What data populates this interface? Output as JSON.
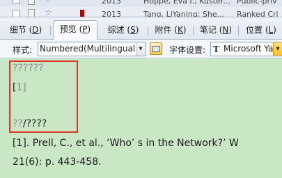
{
  "top_rows": [
    {
      "year": "2013",
      "authors": "Hoppe, Eva I.; Kuster...",
      "source": "Public-priv"
    },
    {
      "year": "2013",
      "authors": "Tang, LiYaning; She...",
      "source": "Ranked Cri"
    }
  ],
  "tabs": [
    {
      "label": "细节",
      "hotkey": "D"
    },
    {
      "label": "预览",
      "hotkey": "P",
      "active": true
    },
    {
      "label": "综述",
      "hotkey": "S"
    },
    {
      "label": "附件",
      "hotkey": "K"
    },
    {
      "label": "笔记",
      "hotkey": "N"
    },
    {
      "label": "位置",
      "hotkey": "L"
    }
  ],
  "toolbar": {
    "style_label": "样式:",
    "style_value": "Numbered(Multilingual",
    "font_label": "字体设置:",
    "font_value": "Microsoft Yah",
    "font_glyph": "T"
  },
  "preview": {
    "raw_line1": "??????",
    "raw_line2_open": "[",
    "raw_line2_num": "1",
    "raw_line2_close": "]",
    "raw_line3_a": "??",
    "raw_line3_b": "/????",
    "citation_line1": "[1].     Prell, C., et al.,   ‘Who’ s in the Network?’   W",
    "citation_line2": "21(6): p. 443-458."
  },
  "colors": {
    "preview_bg": "#c9e7c4",
    "highlight_border": "#e2342a",
    "flag": "#c00000"
  }
}
